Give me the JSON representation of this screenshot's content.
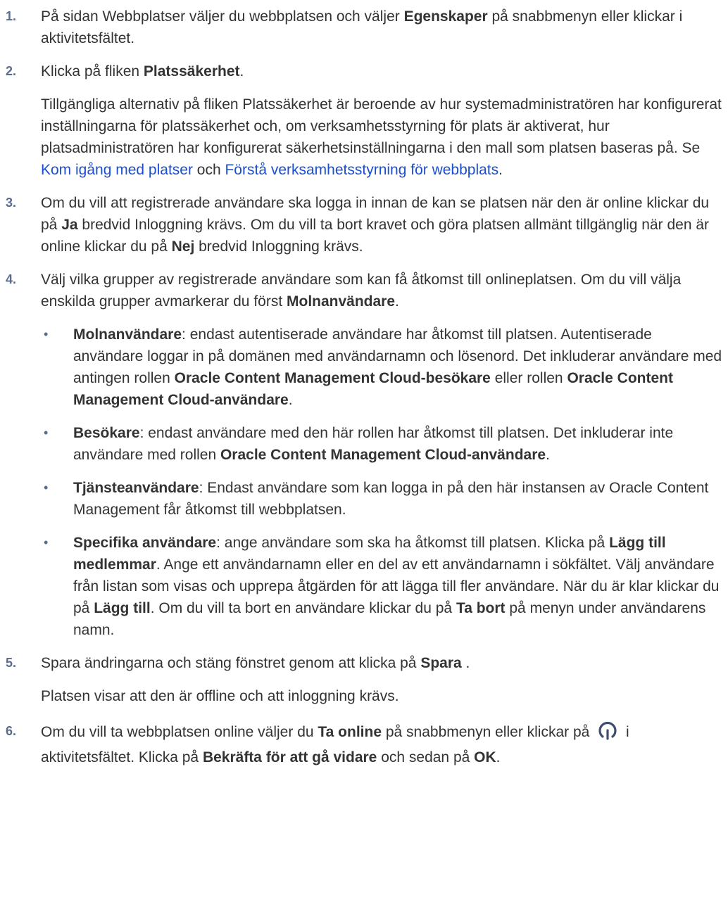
{
  "steps": [
    {
      "num": "1.",
      "segments": [
        {
          "t": "På sidan Webbplatser väljer du webbplatsen och väljer "
        },
        {
          "t": "Egenskaper",
          "b": true
        },
        {
          "t": " på snabbmenyn eller klickar i aktivitetsfältet."
        }
      ]
    },
    {
      "num": "2.",
      "segments": [
        {
          "t": "Klicka på fliken "
        },
        {
          "t": "Platssäkerhet",
          "b": true
        },
        {
          "t": "."
        }
      ],
      "after": [
        {
          "t": "Tillgängliga alternativ på fliken Platssäkerhet är beroende av hur systemadministratören har konfigurerat inställningarna för platssäkerhet och, om verksamhetsstyrning för plats är aktiverat, hur platsadministratören har konfigurerat säkerhetsinställningarna i den mall som platsen baseras på. Se "
        },
        {
          "t": "Kom igång med platser",
          "link": true
        },
        {
          "t": " och "
        },
        {
          "t": "Förstå verksamhetsstyrning för webbplats",
          "link": true
        },
        {
          "t": "."
        }
      ]
    },
    {
      "num": "3.",
      "segments": [
        {
          "t": "Om du vill att registrerade användare ska logga in innan de kan se platsen när den är online klickar du på "
        },
        {
          "t": "Ja",
          "b": true
        },
        {
          "t": " bredvid Inloggning krävs. Om du vill ta bort kravet och göra platsen allmänt tillgänglig när den är online klickar du på "
        },
        {
          "t": "Nej",
          "b": true
        },
        {
          "t": " bredvid Inloggning krävs."
        }
      ]
    },
    {
      "num": "4.",
      "segments": [
        {
          "t": "Välj vilka grupper av registrerade användare som kan få åtkomst till onlineplatsen. Om du vill välja enskilda grupper avmarkerar du först "
        },
        {
          "t": "Molnanvändare",
          "b": true
        },
        {
          "t": "."
        }
      ],
      "bullets": [
        [
          {
            "t": "Molnanvändare",
            "b": true
          },
          {
            "t": ": endast autentiserade användare har åtkomst till platsen. Autentiserade användare loggar in på domänen med användarnamn och lösenord. Det inkluderar användare med antingen rollen "
          },
          {
            "t": "Oracle Content Management Cloud-besökare",
            "b": true
          },
          {
            "t": " eller rollen "
          },
          {
            "t": "Oracle Content Management Cloud-användare",
            "b": true
          },
          {
            "t": "."
          }
        ],
        [
          {
            "t": "Besökare",
            "b": true
          },
          {
            "t": ": endast användare med den här rollen har åtkomst till platsen. Det inkluderar inte användare med rollen "
          },
          {
            "t": "Oracle Content Management Cloud-användare",
            "b": true
          },
          {
            "t": "."
          }
        ],
        [
          {
            "t": "Tjänsteanvändare",
            "b": true
          },
          {
            "t": ": Endast användare som kan logga in på den här instansen av Oracle Content Management får åtkomst till webbplatsen."
          }
        ],
        [
          {
            "t": "Specifika användare",
            "b": true
          },
          {
            "t": ": ange användare som ska ha åtkomst till platsen. Klicka på "
          },
          {
            "t": "Lägg till medlemmar",
            "b": true
          },
          {
            "t": ". Ange ett användarnamn eller en del av ett användarnamn i sökfältet. Välj användare från listan som visas och upprepa åtgärden för att lägga till fler användare. När du är klar klickar du på "
          },
          {
            "t": "Lägg till",
            "b": true
          },
          {
            "t": ". Om du vill ta bort en användare klickar du på "
          },
          {
            "t": "Ta bort",
            "b": true
          },
          {
            "t": " på menyn under användarens namn."
          }
        ]
      ]
    },
    {
      "num": "5.",
      "segments": [
        {
          "t": "Spara ändringarna och stäng fönstret genom att klicka på "
        },
        {
          "t": "Spara",
          "b": true
        },
        {
          "t": " ."
        }
      ],
      "after": [
        {
          "t": "Platsen visar att den är offline och att inloggning krävs."
        }
      ]
    },
    {
      "num": "6.",
      "segments": [
        {
          "t": "Om du vill ta webbplatsen online väljer du "
        },
        {
          "t": "Ta online",
          "b": true
        },
        {
          "t": " på snabbmenyn eller klickar på "
        },
        {
          "icon": "power-icon"
        },
        {
          "t": " i aktivitetsfältet. Klicka på "
        },
        {
          "t": "Bekräfta för att gå vidare",
          "b": true
        },
        {
          "t": " och sedan på "
        },
        {
          "t": "OK",
          "b": true
        },
        {
          "t": "."
        }
      ]
    }
  ],
  "colors": {
    "text": "#333333",
    "link": "#1a4fd1",
    "number": "#5a6c8b",
    "icon": "#3f4f6b"
  }
}
